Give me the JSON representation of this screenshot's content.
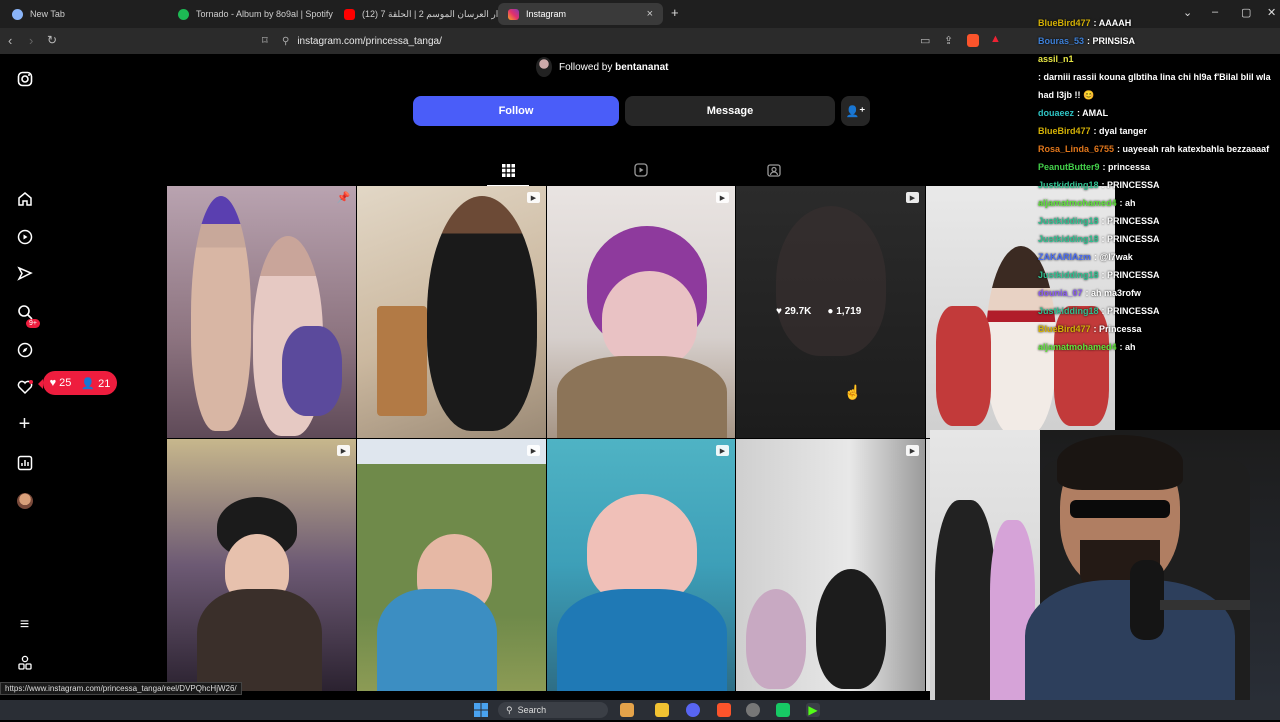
{
  "browser": {
    "tabs": [
      {
        "label": "New Tab",
        "icon": "globe-icon",
        "color": "#8ab4f8"
      },
      {
        "label": "Tornado - Album by 8o9al | Spotify",
        "icon": "spotify-icon",
        "color": "#1db954"
      },
      {
        "label": "(12) دار العرسان الموسم 2 | الحلقة 7",
        "icon": "youtube-icon",
        "color": "#ff0000"
      },
      {
        "label": "Instagram",
        "icon": "instagram-icon",
        "color": "#e1306c"
      }
    ],
    "add_tab": "+",
    "url": "instagram.com/princessa_tanga/"
  },
  "profile": {
    "followed_by_prefix": "Followed by",
    "followed_by_user": "bentananat",
    "follow_label": "Follow",
    "message_label": "Message",
    "follow_color": "#4a5df9"
  },
  "sidebar": {
    "notification_likes": "25",
    "notification_follows": "21",
    "reels_badge": "9+"
  },
  "post_stats": {
    "likes": "29.7K",
    "comments": "1,719"
  },
  "chat": [
    {
      "user": "BlueBird477",
      "text": ": AAAAH",
      "color": "#d4b106"
    },
    {
      "user": "Bouras_53",
      "text": ": PRINSISA",
      "color": "#3d7fd6"
    },
    {
      "user": "assil_n1",
      "text": ": darniii rassii kouna glbtiha lina chi hl9a f'Bilal blil wla had l3jb !! 😊",
      "color": "#e6e645"
    },
    {
      "user": "douaeez",
      "text": ": AMAL",
      "color": "#2fc4c4"
    },
    {
      "user": "BlueBird477",
      "text": ": dyal tanger",
      "color": "#d4b106"
    },
    {
      "user": "Rosa_Linda_6755",
      "text": ": uayeeah rah katexbahla bezzaaaaf",
      "color": "#e0761b"
    },
    {
      "user": "PeanutButter9",
      "text": ": princessa",
      "color": "#43d04a"
    },
    {
      "user": "Justkidding18",
      "text": ": PRINCESSA",
      "color": "#2fbf8f"
    },
    {
      "user": "aljamatmohamed4",
      "text": ": ah",
      "color": "#5fe33a"
    },
    {
      "user": "Justkidding18",
      "text": ": PRINCESSA",
      "color": "#2fbf8f"
    },
    {
      "user": "Justkidding18",
      "text": ": PRINCESSA",
      "color": "#2fbf8f"
    },
    {
      "user": "ZAKARIAzm",
      "text": ": @l7wak",
      "color": "#4a6cf0"
    },
    {
      "user": "Justkidding18",
      "text": ": PRINCESSA",
      "color": "#2fbf8f"
    },
    {
      "user": "dounia_07",
      "text": ": ah ma3rofw",
      "color": "#8a5cf0"
    },
    {
      "user": "Justkidding18",
      "text": ": PRINCESSA",
      "color": "#2fbf8f"
    },
    {
      "user": "BlueBird477",
      "text": ": Princessa",
      "color": "#d4b106"
    },
    {
      "user": "aljamatmohamed4",
      "text": ": ah",
      "color": "#5fe33a"
    }
  ],
  "status_url": "https://www.instagram.com/princessa_tanga/reel/DVPQhcHjW26/",
  "taskbar": {
    "search_label": "Search"
  }
}
